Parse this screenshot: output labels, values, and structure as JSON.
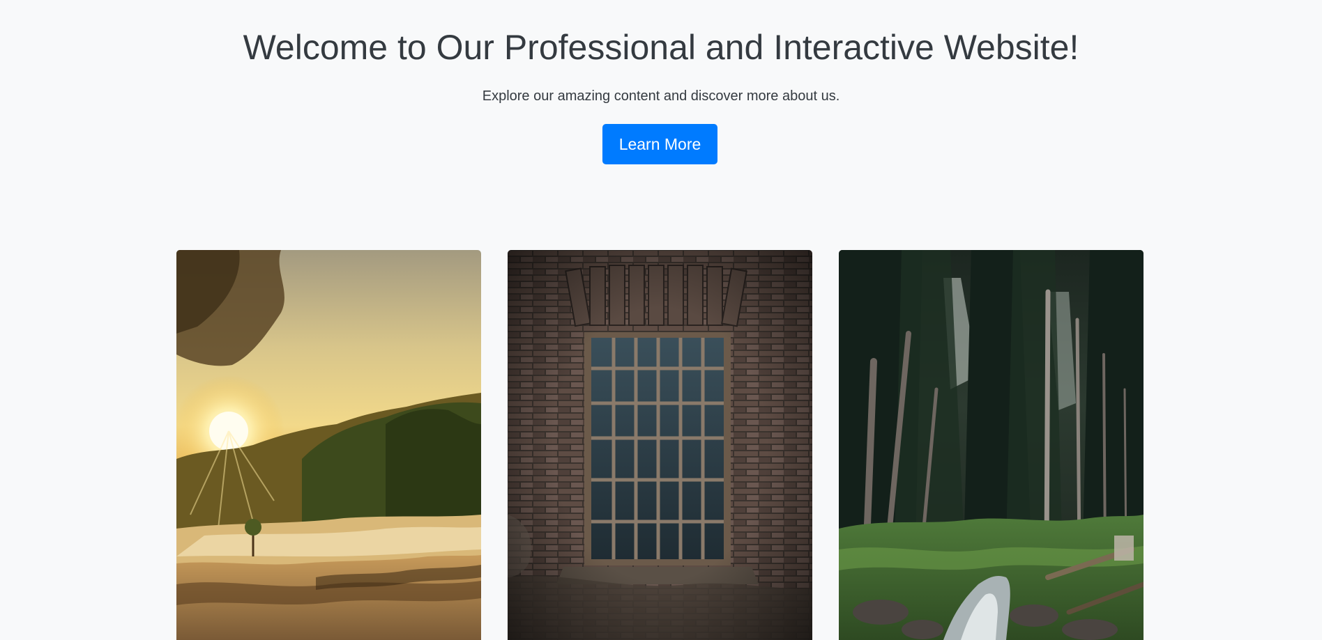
{
  "hero": {
    "title": "Welcome to Our Professional and Interactive Website!",
    "subtitle": "Explore our amazing content and discover more about us.",
    "cta_label": "Learn More"
  },
  "gallery": {
    "images": [
      {
        "subject": "sunset over rocky river with trees"
      },
      {
        "subject": "barred window in old brick wall"
      },
      {
        "subject": "dense pine forest with stream"
      }
    ]
  },
  "colors": {
    "background": "#f8f9fa",
    "text": "#343a40",
    "accent": "#007bff"
  }
}
